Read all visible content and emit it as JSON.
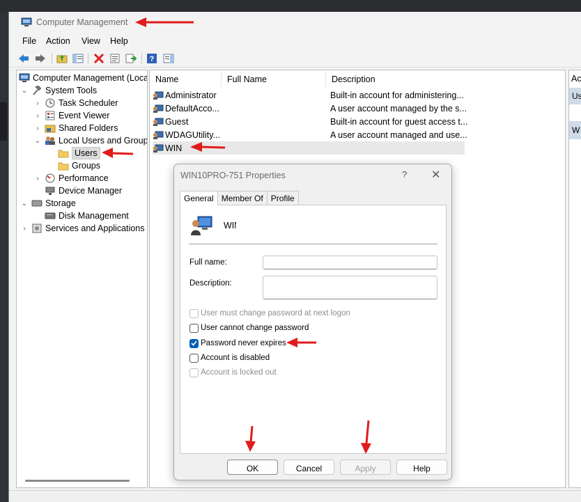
{
  "window": {
    "title": "Computer Management"
  },
  "menu": [
    "File",
    "Action",
    "View",
    "Help"
  ],
  "toolbar": {
    "icons": [
      "back-arrow-icon",
      "forward-arrow-icon",
      "up-folder-icon",
      "show-hide-tree-icon",
      "delete-icon",
      "properties-icon",
      "export-list-icon",
      "help-icon",
      "show-hide-action-pane-icon"
    ]
  },
  "tree": [
    {
      "label": "Computer Management (Local",
      "icon": "computer-management-icon"
    },
    {
      "label": "System Tools",
      "icon": "tools-icon"
    },
    {
      "label": "Task Scheduler",
      "icon": "clock-icon"
    },
    {
      "label": "Event Viewer",
      "icon": "event-viewer-icon"
    },
    {
      "label": "Shared Folders",
      "icon": "shared-folder-icon"
    },
    {
      "label": "Local Users and Groups",
      "icon": "users-groups-icon"
    },
    {
      "label": "Users",
      "icon": "folder-icon"
    },
    {
      "label": "Groups",
      "icon": "folder-icon"
    },
    {
      "label": "Performance",
      "icon": "performance-icon"
    },
    {
      "label": "Device Manager",
      "icon": "device-manager-icon"
    },
    {
      "label": "Storage",
      "icon": "storage-icon"
    },
    {
      "label": "Disk Management",
      "icon": "disk-icon"
    },
    {
      "label": "Services and Applications",
      "icon": "services-icon"
    }
  ],
  "list": {
    "columns": [
      "Name",
      "Full Name",
      "Description"
    ],
    "rows": [
      {
        "name": "Administrator",
        "full_name": "",
        "description": "Built-in account for administering..."
      },
      {
        "name": "DefaultAcco...",
        "full_name": "",
        "description": "A user account managed by the s..."
      },
      {
        "name": "Guest",
        "full_name": "",
        "description": "Built-in account for guest access t..."
      },
      {
        "name": "WDAGUtility...",
        "full_name": "",
        "description": "A user account managed and use..."
      },
      {
        "name": "WIN",
        "full_name": "",
        "description": ""
      }
    ]
  },
  "actions": {
    "header": "Ac",
    "items": [
      "Us",
      "W"
    ]
  },
  "dialog": {
    "title": "WIN10PRO-751 Properties",
    "help_glyph": "?",
    "close_glyph": "✕",
    "tabs": [
      "General",
      "Member Of",
      "Profile"
    ],
    "active_tab": "General",
    "user_name": "WIN",
    "full_name_label": "Full name:",
    "full_name_value": "",
    "description_label": "Description:",
    "description_value": "",
    "checkboxes": [
      {
        "label": "User must change password at next logon",
        "checked": false,
        "disabled": true
      },
      {
        "label": "User cannot change password",
        "checked": false,
        "disabled": false
      },
      {
        "label": "Password never expires",
        "checked": true,
        "disabled": false
      },
      {
        "label": "Account is disabled",
        "checked": false,
        "disabled": false
      },
      {
        "label": "Account is locked out",
        "checked": false,
        "disabled": true
      }
    ],
    "buttons": {
      "ok": "OK",
      "cancel": "Cancel",
      "apply": "Apply",
      "help": "Help"
    }
  },
  "colors": {
    "annotation_arrow": "#e11b1b",
    "checkbox_accent": "#005fb8",
    "selection": "#dcdcdc"
  }
}
